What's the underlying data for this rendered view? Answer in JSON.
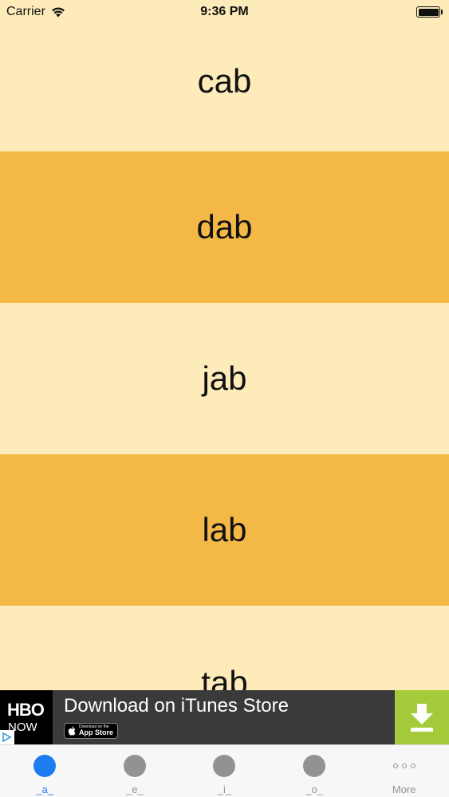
{
  "status_bar": {
    "carrier": "Carrier",
    "time": "9:36 PM"
  },
  "list": {
    "items": [
      {
        "label": "cab",
        "color": "#FDEBB9"
      },
      {
        "label": "dab",
        "color": "#F3B846"
      },
      {
        "label": "jab",
        "color": "#FDEBB9"
      },
      {
        "label": "lab",
        "color": "#F3B846"
      },
      {
        "label": "tab",
        "color": "#FDEBB9"
      }
    ]
  },
  "ad": {
    "logo_line1": "HBO",
    "logo_line2": "NOW",
    "title": "Download on iTunes Store",
    "store_small": "Download on the",
    "store_big": "App Store",
    "download_color": "#A5CA3A"
  },
  "tab_bar": {
    "active_color": "#1E7CF2",
    "inactive_color": "#929292",
    "tabs": [
      {
        "label": "_a_",
        "active": true
      },
      {
        "label": "_e_",
        "active": false
      },
      {
        "label": "_i_",
        "active": false
      },
      {
        "label": "_o_",
        "active": false
      },
      {
        "label": "More",
        "active": false,
        "icon": "more-icon"
      }
    ]
  }
}
